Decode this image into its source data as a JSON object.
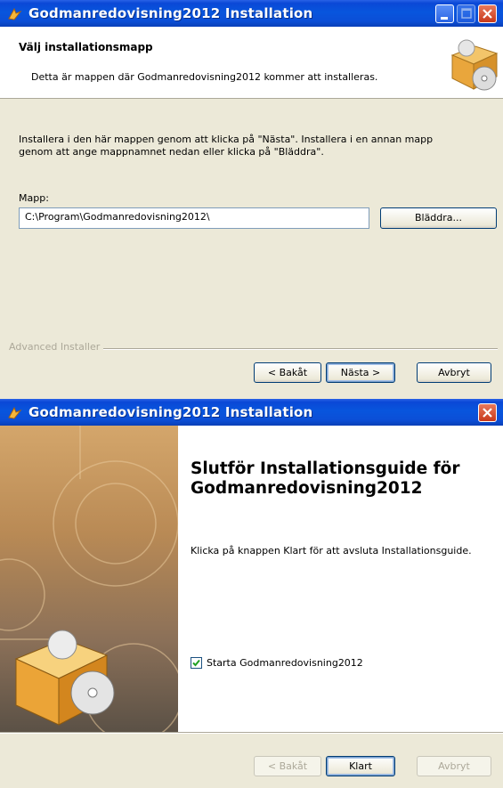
{
  "window1": {
    "title": "Godmanredovisning2012 Installation",
    "header_title": "Välj installationsmapp",
    "header_subtitle": "Detta är mappen där Godmanredovisning2012 kommer att installeras.",
    "instructions_line1": "Installera i den här mappen genom att klicka på \"Nästa\". Installera i en annan mapp",
    "instructions_line2": "genom att ange mappnamnet nedan eller klicka på \"Bläddra\".",
    "folder_label": "Mapp:",
    "folder_value": "C:\\Program\\Godmanredovisning2012\\",
    "browse_label": "Bläddra...",
    "footer_brand": "Advanced Installer",
    "back_label": "< Bakåt",
    "next_label": "Nästa >",
    "cancel_label": "Avbryt"
  },
  "window2": {
    "title": "Godmanredovisning2012 Installation",
    "finish_title": "Slutför Installationsguide för Godmanredovisning2012",
    "finish_text": "Klicka på knappen Klart för att avsluta Installationsguide.",
    "launch_label": "Starta Godmanredovisning2012",
    "launch_checked": true,
    "back_label": "< Bakåt",
    "finish_label": "Klart",
    "cancel_label": "Avbryt"
  },
  "colors": {
    "titlebar": "#0a48d6",
    "dialog_bg": "#ece9d8",
    "close_button": "#c8391b"
  },
  "icons": [
    "installer-app-icon",
    "minimize-icon",
    "maximize-icon",
    "close-icon",
    "installer-box-icon",
    "checkmark-icon"
  ]
}
